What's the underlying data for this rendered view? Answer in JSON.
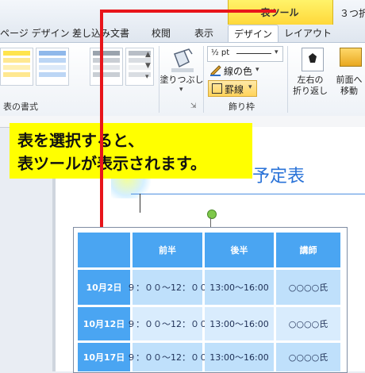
{
  "window_title": "３つ折",
  "context_tab_label": "表ツール",
  "tabs": [
    "ページ デザイン",
    "差し込み文書",
    "校閲",
    "表示",
    "デザイン",
    "レイアウト"
  ],
  "ribbon": {
    "table_styles_group": "表の書式",
    "shading_button": "塗りつぶし",
    "pen_weight": "½ pt",
    "pen_color": "線の色",
    "borders": "罫線",
    "draw_borders_group": "飾り枠",
    "wrap_text": [
      "左右の",
      "折り返し"
    ],
    "bring_forward": [
      "前面へ",
      "移動"
    ]
  },
  "callout": {
    "line1": "表を選択すると、",
    "line2": "表ツールが表示されます。"
  },
  "document_title": "予定表",
  "table": {
    "headers": [
      "",
      "前半",
      "後半",
      "講師"
    ],
    "rows": [
      [
        "10月2日",
        "９：００〜12：００",
        "13:00〜16:00",
        "○○○○氏"
      ],
      [
        "10月12日",
        "９：００〜12：００",
        "13:00〜16:00",
        "○○○○氏"
      ],
      [
        "10月17日",
        "９：００〜12：００",
        "13:00〜16:00",
        "○○○○氏"
      ]
    ]
  },
  "colors": {
    "accent_red": "#e8151b",
    "callout_yellow": "#ffff00",
    "table_header_blue": "#4aa5f2",
    "table_cell_blue": "#bfe0fb"
  }
}
